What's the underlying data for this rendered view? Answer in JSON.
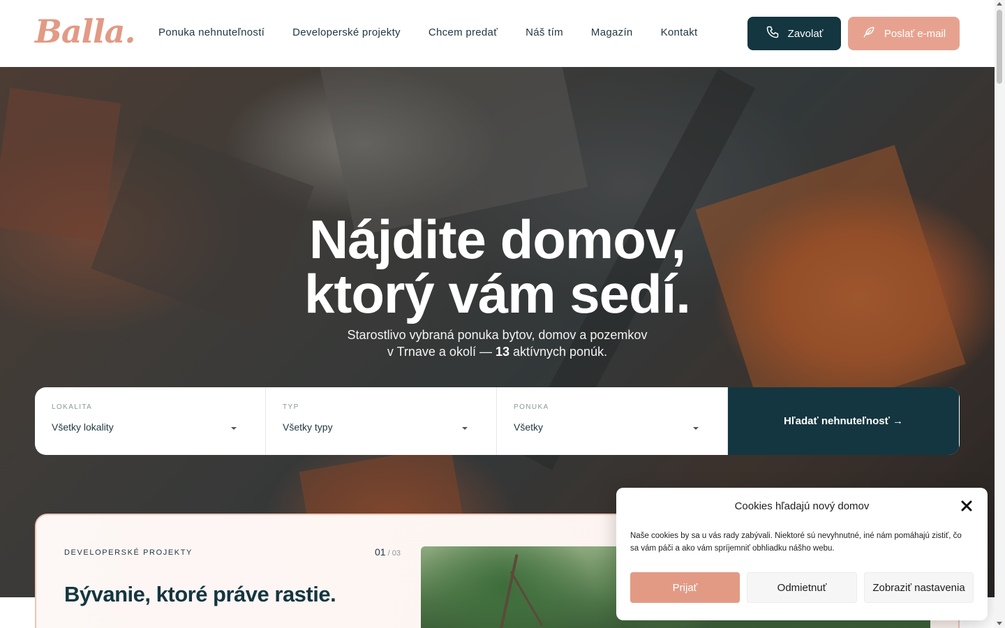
{
  "header": {
    "logo": "Balla.",
    "nav": [
      {
        "label": "Ponuka nehnuteľností"
      },
      {
        "label": "Developerské projekty"
      },
      {
        "label": "Chcem predať"
      },
      {
        "label": "Náš tím"
      },
      {
        "label": "Magazín"
      },
      {
        "label": "Kontakt"
      }
    ],
    "call_label": "Zavolať",
    "mail_label": "Poslať e-mail",
    "colors": {
      "dark": "#143640",
      "accent": "#e7a28f"
    }
  },
  "hero": {
    "title_line1": "Nájdite domov,",
    "title_line2": "ktorý vám sedí.",
    "subtitle_line1": "Starostlivo vybraná ponuka bytov, domov a pozemkov",
    "subtitle_line2_prefix": "v Trnave a okolí — ",
    "active_count": "13",
    "subtitle_line2_suffix": " aktívnych ponúk."
  },
  "search": {
    "fields": [
      {
        "label": "LOKALITA",
        "value": "Všetky lokality"
      },
      {
        "label": "TYP",
        "value": "Všetky typy"
      },
      {
        "label": "PONUKA",
        "value": "Všetky"
      }
    ],
    "button_label": "Hľadať nehnuteľnosť →"
  },
  "developer": {
    "eyebrow": "DEVELOPERSKÉ PROJEKTY",
    "current": "01",
    "total": " / 03",
    "title": "Bývanie, ktoré práve rastie."
  },
  "cookie": {
    "title": "Cookies hľadajú nový domov",
    "text": "Naše cookies by sa u vás rady zabývali. Niektoré sú nevyhnutné, iné nám pomáhajú zistiť, čo sa vám páči a ako vám spríjemniť obhliadku nášho webu.",
    "accept": "Prijať",
    "deny": "Odmietnuť",
    "settings": "Zobraziť nastavenia"
  }
}
